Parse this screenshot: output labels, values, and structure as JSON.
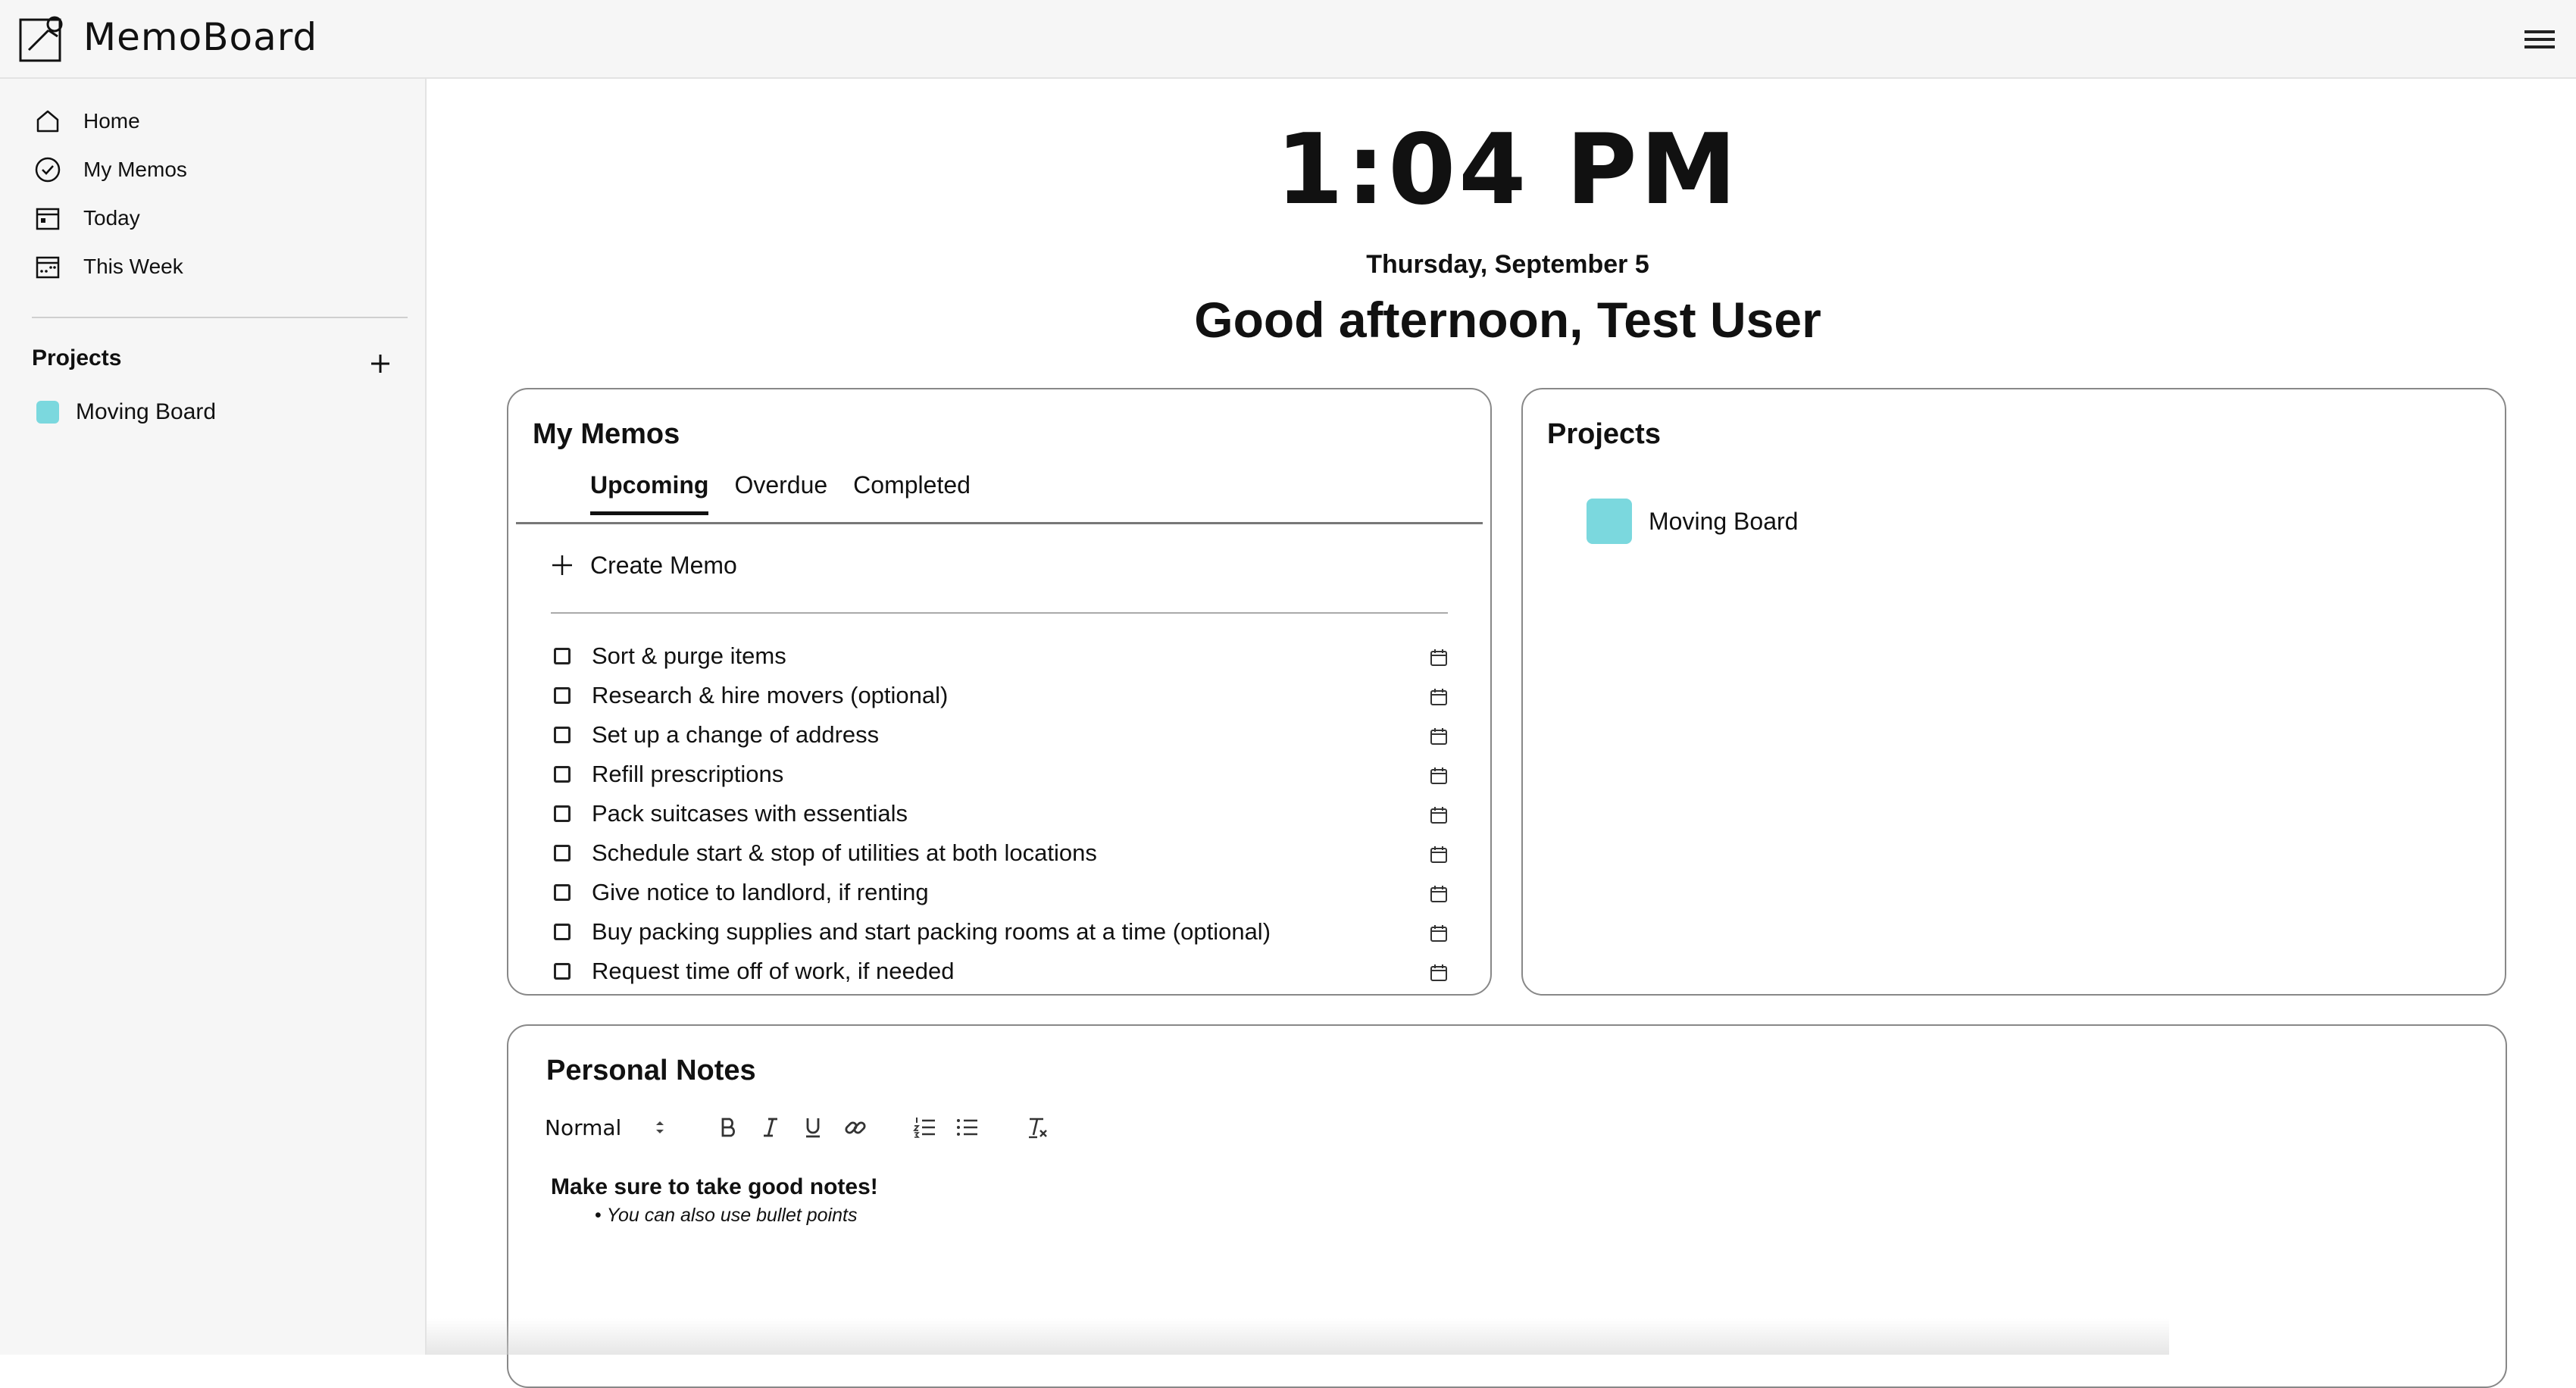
{
  "app": {
    "name": "MemoBoard"
  },
  "sidebar": {
    "nav": [
      {
        "label": "Home",
        "icon": "home-icon"
      },
      {
        "label": "My Memos",
        "icon": "check-circle-icon"
      },
      {
        "label": "Today",
        "icon": "calendar-today-icon"
      },
      {
        "label": "This Week",
        "icon": "calendar-week-icon"
      }
    ],
    "projects_title": "Projects",
    "projects": [
      {
        "label": "Moving Board",
        "color": "#7bd8de"
      }
    ]
  },
  "header": {
    "time": "1:04 PM",
    "date": "Thursday, September 5",
    "greeting": "Good afternoon, Test User"
  },
  "memos": {
    "title": "My Memos",
    "tabs": [
      "Upcoming",
      "Overdue",
      "Completed"
    ],
    "active_tab": "Upcoming",
    "create_label": "Create Memo",
    "items": [
      "Sort & purge items",
      "Research & hire movers (optional)",
      "Set up a change of address",
      "Refill prescriptions",
      "Pack suitcases with essentials",
      "Schedule start & stop of utilities at both locations",
      "Give notice to landlord, if renting",
      "Buy packing supplies and start packing rooms at a time (optional)",
      "Request time off of work, if needed"
    ]
  },
  "projects_card": {
    "title": "Projects",
    "items": [
      {
        "label": "Moving Board",
        "color": "#7bd8de"
      }
    ]
  },
  "notes": {
    "title": "Personal Notes",
    "format_select": "Normal",
    "toolbar_icons": [
      "bold-icon",
      "italic-icon",
      "underline-icon",
      "link-icon",
      "ordered-list-icon",
      "bullet-list-icon",
      "clear-format-icon"
    ],
    "content_heading": "Make sure to take good notes!",
    "content_bullet": "You can also use bullet points"
  }
}
